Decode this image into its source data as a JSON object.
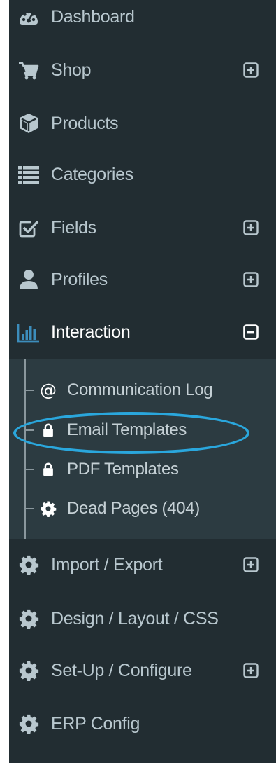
{
  "menu": {
    "dashboard": {
      "label": "Dashboard",
      "icon": "dashboard-icon"
    },
    "shop": {
      "label": "Shop",
      "icon": "shopping-cart-icon",
      "toggle": "expand"
    },
    "products": {
      "label": "Products",
      "icon": "cube-icon"
    },
    "categories": {
      "label": "Categories",
      "icon": "list-icon"
    },
    "fields": {
      "label": "Fields",
      "icon": "check-square-icon",
      "toggle": "expand"
    },
    "profiles": {
      "label": "Profiles",
      "icon": "user-icon",
      "toggle": "expand"
    },
    "interaction": {
      "label": "Interaction",
      "icon": "bar-chart-icon",
      "toggle": "collapse",
      "active": true
    },
    "interaction_sub": [
      {
        "label": "Communication Log",
        "icon": "at-icon"
      },
      {
        "label": "Email Templates",
        "icon": "lock-icon",
        "highlighted": true
      },
      {
        "label": "PDF Templates",
        "icon": "lock-icon"
      },
      {
        "label": "Dead Pages (404)",
        "icon": "gear-icon"
      }
    ],
    "import_export": {
      "label": "Import / Export",
      "icon": "gear-icon",
      "toggle": "expand"
    },
    "design": {
      "label": "Design / Layout / CSS",
      "icon": "gear-icon"
    },
    "setup": {
      "label": "Set-Up / Configure",
      "icon": "gear-icon",
      "toggle": "expand"
    },
    "erp": {
      "label": "ERP Config",
      "icon": "gear-icon"
    }
  },
  "colors": {
    "sidebar_bg": "#222d32",
    "submenu_bg": "#2c3b41",
    "text": "#b8c7ce",
    "active_text": "#ffffff",
    "accent": "#3c8dbc",
    "highlight_ring": "#2aa7dd"
  }
}
